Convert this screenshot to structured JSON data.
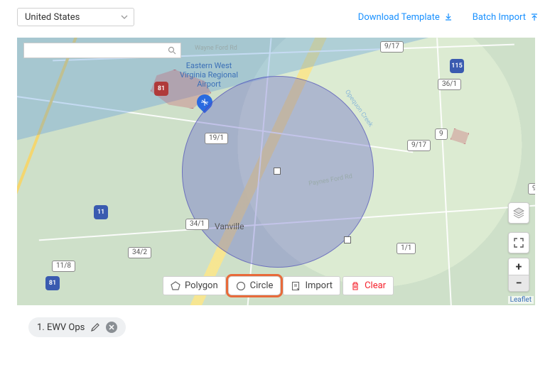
{
  "topbar": {
    "country_select": {
      "value": "United States"
    },
    "download_template": "Download Template",
    "batch_import": "Batch Import"
  },
  "map": {
    "search_value": "",
    "airport_label": "Eastern West Virginia Regional Airport",
    "town": "Vanville",
    "shields": {
      "s_i81a": "81",
      "s_i81b": "81",
      "s_115": "115",
      "s_36_1": "36/1",
      "s_9a": "9",
      "s_9b": "9",
      "s_9_17": "9/17",
      "s_9_17b": "9/17",
      "s_1_1": "1/1",
      "s_19_1": "19/1",
      "s_34_1": "34/1",
      "s_34_2": "34/2",
      "s_11_8": "11/8",
      "s_11": "11"
    },
    "zoom_in": "+",
    "zoom_out": "−",
    "leaflet": "Leaflet"
  },
  "toolbar": {
    "polygon": "Polygon",
    "circle": "Circle",
    "import": "Import",
    "clear": "Clear"
  },
  "zone_chip": {
    "label": "1. EWV Ops"
  },
  "road_labels": {
    "wayne_ford": "Wayne Ford Rd",
    "paynes_ford": "Paynes Ford Rd",
    "opequon": "Opequon Creek"
  }
}
